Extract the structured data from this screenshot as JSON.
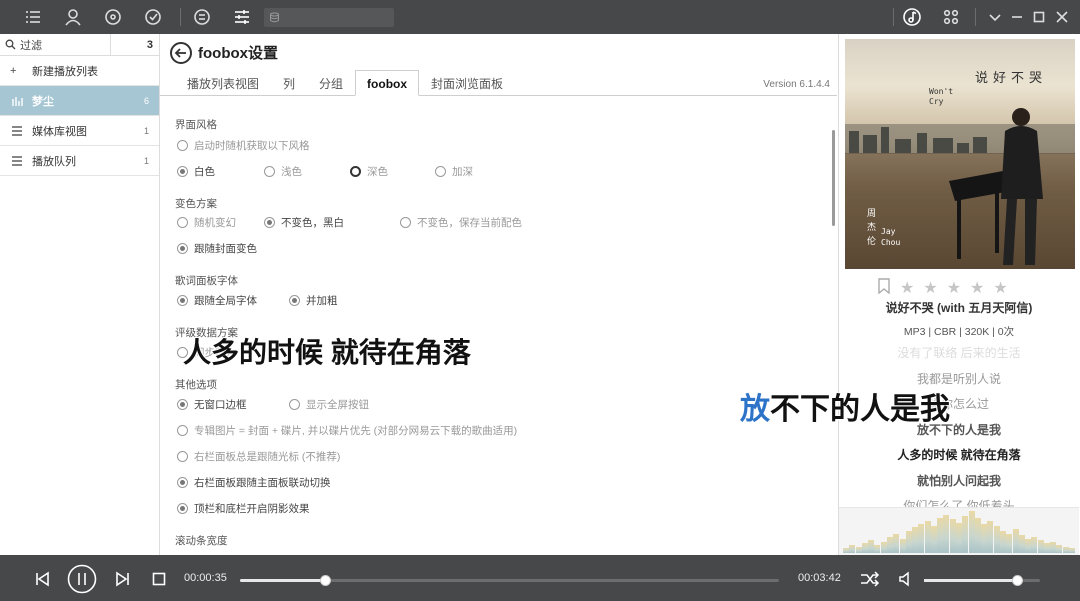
{
  "sidebar": {
    "filter_label": "过滤",
    "filter_count": "3",
    "new_playlist": "新建播放列表",
    "items": [
      {
        "label": "梦尘",
        "count": "6"
      },
      {
        "label": "媒体库视图",
        "count": "1"
      },
      {
        "label": "播放队列",
        "count": "1"
      }
    ]
  },
  "header": {
    "title": "foobox设置",
    "tabs": [
      "播放列表视图",
      "列",
      "分组",
      "foobox",
      "封面浏览面板"
    ],
    "active_tab": "foobox",
    "version": "Version 6.1.4.4"
  },
  "settings": {
    "ui_style": {
      "heading": "界面风格",
      "random": "启动时随机获取以下风格",
      "options": [
        "白色",
        "浅色",
        "深色",
        "加深"
      ]
    },
    "color_scheme": {
      "heading": "变色方案",
      "options": [
        "随机变幻",
        "不变色，黑白",
        "不变色，保存当前配色",
        "跟随封面变色"
      ]
    },
    "lyrics_font": {
      "heading": "歌词面板字体",
      "options": [
        "跟随全局字体",
        "并加粗"
      ]
    },
    "rating": {
      "heading": "评级数据方案",
      "option": "同步写入"
    },
    "other": {
      "heading": "其他选项",
      "options": [
        "无窗口边框",
        "显示全屏按钮",
        "专辑图片 = 封面 + 碟片, 并以碟片优先 (对部分网易云下载的歌曲适用)",
        "右栏面板总是跟随光标 (不推荐)",
        "右栏面板跟随主面板联动切换",
        "顶栏和底栏开启阴影效果"
      ]
    },
    "scroll": {
      "heading": "滚动条宽度"
    }
  },
  "cover": {
    "title_cn": "说好不哭",
    "title_en_1": "Won't",
    "title_en_2": "Cry",
    "artist_cn": "周杰伦",
    "artist_en_1": "Jay",
    "artist_en_2": "Chou"
  },
  "now_playing": {
    "title": "说好不哭 (with 五月天阿信)",
    "meta": "MP3 | CBR | 320K | 0次",
    "rating_stars": 0,
    "lyrics": [
      "没有了联络 后来的生活",
      "我都是听别人说",
      "说你怎么过",
      "放不下的人是我",
      "人多的时候 就待在角落",
      "就怕别人问起我",
      "你们怎么了 你低着头"
    ],
    "current_lyric_index": 4
  },
  "overlay": {
    "line1": "人多的时候 就待在角落",
    "line2_highlight": "放",
    "line2_rest": "不下的人是我"
  },
  "player": {
    "time_current": "00:00:35",
    "time_total": "00:03:42",
    "progress": 0.158,
    "volume": 0.8
  },
  "spectrum": [
    3,
    5,
    4,
    6,
    8,
    5,
    7,
    10,
    12,
    9,
    14,
    16,
    18,
    20,
    17,
    22,
    24,
    21,
    19,
    23,
    26,
    22,
    18,
    20,
    17,
    14,
    12,
    15,
    11,
    9,
    10,
    8,
    6,
    7,
    5,
    4,
    3
  ]
}
